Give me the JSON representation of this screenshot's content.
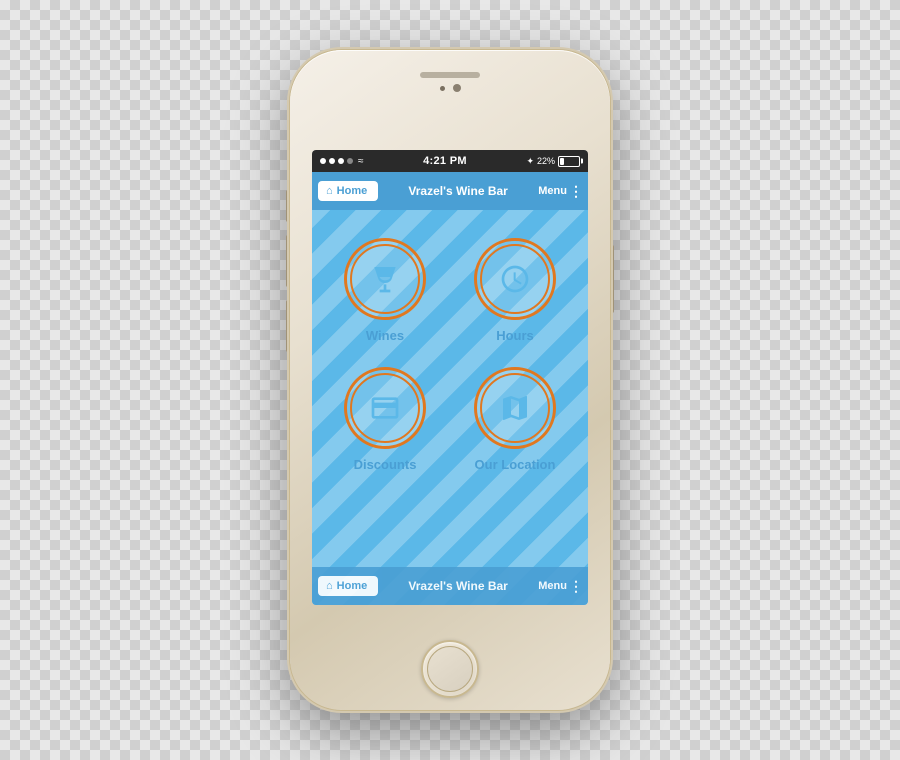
{
  "phone": {
    "status_bar": {
      "time": "4:21 PM",
      "battery_percent": "22%",
      "signal": "●●●○○"
    },
    "nav_bar": {
      "home_label": "Home",
      "title": "Vrazel's Wine Bar",
      "menu_label": "Menu"
    },
    "app": {
      "items": [
        {
          "id": "wines",
          "label": "Wines",
          "icon": "wine-glass-icon"
        },
        {
          "id": "hours",
          "label": "Hours",
          "icon": "clock-icon"
        },
        {
          "id": "discounts",
          "label": "Discounts",
          "icon": "card-icon"
        },
        {
          "id": "location",
          "label": "Our Location",
          "icon": "map-icon"
        }
      ]
    },
    "colors": {
      "accent_blue": "#4a9fd4",
      "accent_orange": "#e07820",
      "bg_blue": "#5bb8e8"
    }
  }
}
